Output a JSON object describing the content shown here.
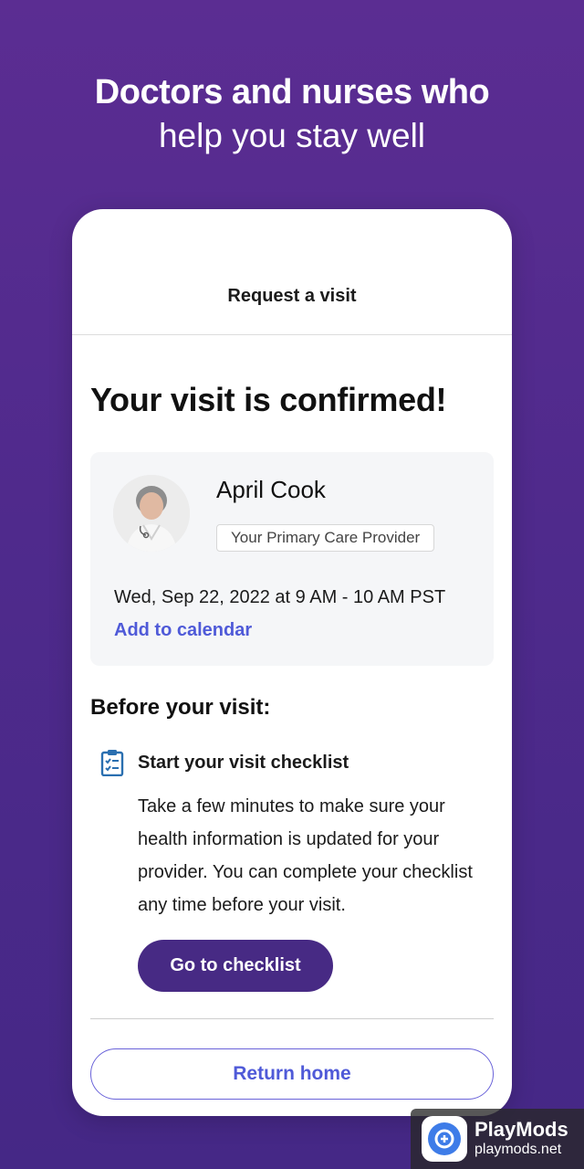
{
  "headline": {
    "line1": "Doctors and nurses who",
    "line2": "help you stay well"
  },
  "screen": {
    "nav_title": "Request a visit",
    "confirmation_title": "Your visit is confirmed!",
    "provider": {
      "name": "April Cook",
      "role_badge": "Your Primary Care Provider",
      "visit_time": "Wed, Sep 22, 2022 at 9 AM - 10 AM PST",
      "add_to_calendar": "Add to calendar"
    },
    "before_visit": {
      "heading": "Before your visit:",
      "checklist_title": "Start your visit checklist",
      "checklist_description": "Take a few minutes to make sure your health information is updated for your provider. You can complete your checklist any time before your visit.",
      "checklist_button": "Go to checklist"
    },
    "return_home": "Return home"
  },
  "watermark": {
    "title": "PlayMods",
    "url": "playmods.net"
  },
  "colors": {
    "background": "#5b2d92",
    "primary_button": "#472a84",
    "link": "#4f5ad8",
    "icon": "#2a6fb0"
  },
  "icons": {
    "checklist": "clipboard-checklist-icon",
    "watermark_logo": "playmods-logo-icon"
  }
}
